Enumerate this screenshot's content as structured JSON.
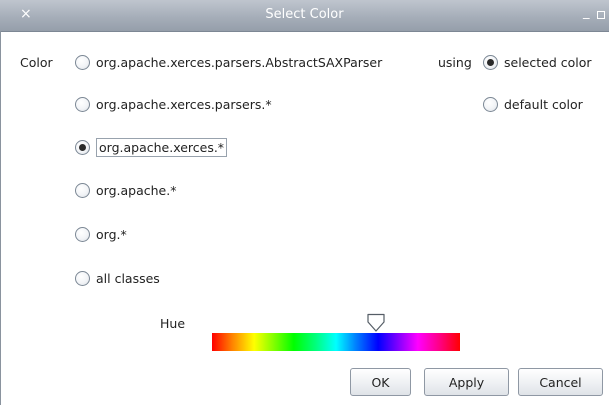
{
  "window": {
    "title": "Select Color",
    "close_glyph": "×",
    "minimize_glyph": "_"
  },
  "color_label": "Color",
  "scope_options": [
    {
      "label": "org.apache.xerces.parsers.AbstractSAXParser",
      "selected": false
    },
    {
      "label": "org.apache.xerces.parsers.*",
      "selected": false
    },
    {
      "label": "org.apache.xerces.*",
      "selected": true
    },
    {
      "label": "org.apache.*",
      "selected": false
    },
    {
      "label": "org.*",
      "selected": false
    },
    {
      "label": "all classes",
      "selected": false
    }
  ],
  "using_label": "using",
  "using_options": [
    {
      "label": "selected color",
      "selected": true
    },
    {
      "label": "default color",
      "selected": false
    }
  ],
  "hue": {
    "label": "Hue",
    "value_fraction": 0.66
  },
  "buttons": {
    "ok": "OK",
    "apply": "Apply",
    "cancel": "Cancel"
  }
}
